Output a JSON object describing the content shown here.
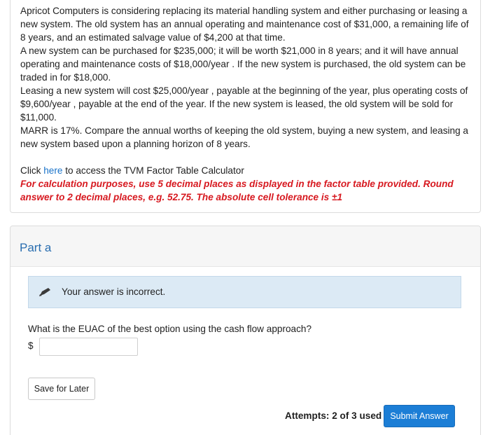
{
  "question": {
    "paragraphs": [
      "Apricot Computers is considering replacing its material handling system and either purchasing or leasing a new system. The old system has an annual operating and maintenance cost of $31,000, a remaining life of 8 years, and an estimated salvage value of $4,200 at that time.",
      "A new system can be purchased for $235,000; it will be worth $21,000 in 8 years; and it will have annual operating and maintenance costs of $18,000/year . If the new system is purchased, the old system can be traded in for $18,000.",
      "Leasing a new system will cost $25,000/year , payable at the beginning of the year, plus operating costs of $9,600/year , payable at the end of the year. If the new system is leased, the old system will be sold for $11,000.",
      "MARR is 17%. Compare the annual worths of keeping the old system, buying a new system, and leasing a new system based upon a planning horizon of 8 years."
    ],
    "click_prefix": "Click ",
    "link_text": "here",
    "click_suffix": " to access the TVM Factor Table Calculator",
    "note": "For calculation purposes, use 5 decimal places as displayed in the factor table provided. Round answer to 2 decimal places, e.g. 52.75. The absolute cell tolerance is ±1"
  },
  "part": {
    "title": "Part a",
    "feedback": "Your answer is incorrect.",
    "prompt": "What is the EUAC of the best option using the cash flow approach?",
    "currency_symbol": "$",
    "answer_value": "",
    "save_label": "Save for Later",
    "attempts": "Attempts: 2 of 3 used",
    "submit_label": "Submit Answer"
  }
}
